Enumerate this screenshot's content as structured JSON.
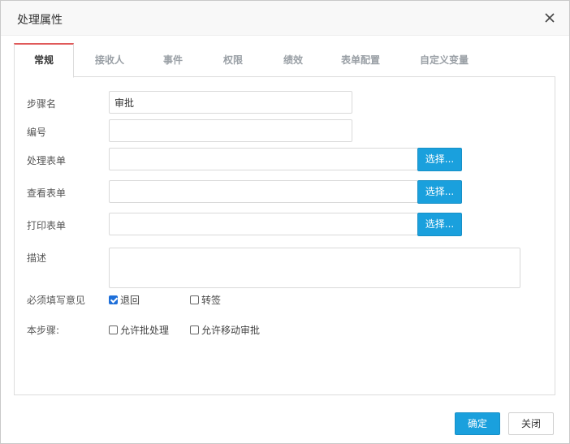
{
  "dialog": {
    "title": "处理属性",
    "close_icon": "close-x-icon"
  },
  "tabs": [
    {
      "label": "常规",
      "active": true
    },
    {
      "label": "接收人",
      "active": false
    },
    {
      "label": "事件",
      "active": false
    },
    {
      "label": "权限",
      "active": false
    },
    {
      "label": "绩效",
      "active": false
    },
    {
      "label": "表单配置",
      "active": false
    },
    {
      "label": "自定义变量",
      "active": false
    }
  ],
  "form": {
    "step_name": {
      "label": "步骤名",
      "value": "审批"
    },
    "number": {
      "label": "编号",
      "value": ""
    },
    "process_form": {
      "label": "处理表单",
      "value": "",
      "button": "选择..."
    },
    "view_form": {
      "label": "查看表单",
      "value": "",
      "button": "选择..."
    },
    "print_form": {
      "label": "打印表单",
      "value": "",
      "button": "选择..."
    },
    "description": {
      "label": "描述",
      "value": ""
    },
    "required_opinion": {
      "label": "必须填写意见",
      "options": [
        {
          "label": "退回",
          "checked": true
        },
        {
          "label": "转签",
          "checked": false
        }
      ]
    },
    "this_step": {
      "label": "本步骤:",
      "options": [
        {
          "label": "允许批处理",
          "checked": false
        },
        {
          "label": "允许移动审批",
          "checked": false
        }
      ]
    }
  },
  "footer": {
    "ok_label": "确定",
    "close_label": "关闭"
  },
  "colors": {
    "accent": "#1aa0dd",
    "active_tab_top": "#e05a5a",
    "checkbox_checked": "#1e6fd9"
  }
}
